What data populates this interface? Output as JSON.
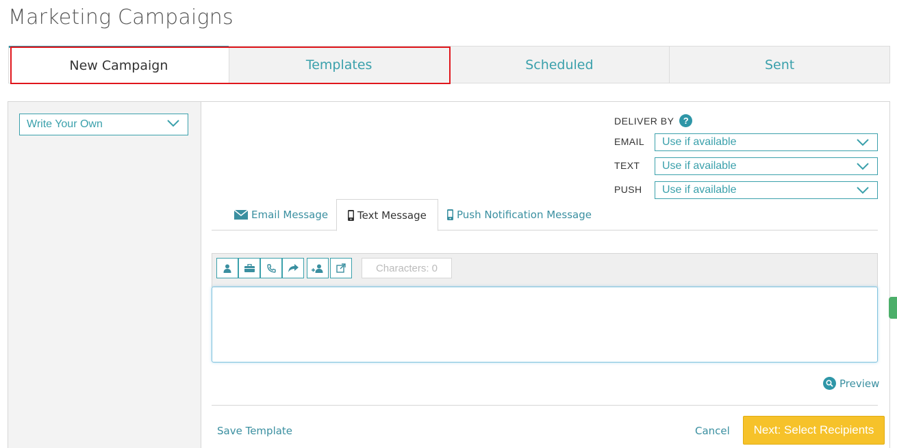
{
  "page": {
    "title": "Marketing Campaigns"
  },
  "top_tabs": [
    {
      "label": "New Campaign",
      "active": true
    },
    {
      "label": "Templates",
      "active": false
    },
    {
      "label": "Scheduled",
      "active": false
    },
    {
      "label": "Sent",
      "active": false
    }
  ],
  "sidebar": {
    "template_select": "Write Your Own"
  },
  "deliver_by": {
    "title": "DELIVER BY",
    "help_icon": "question-circle-icon",
    "rows": [
      {
        "label": "EMAIL",
        "value": "Use if available"
      },
      {
        "label": "TEXT",
        "value": "Use if available"
      },
      {
        "label": "PUSH",
        "value": "Use if available"
      }
    ]
  },
  "message_tabs": [
    {
      "label": "Email Message",
      "icon": "envelope-icon",
      "active": false
    },
    {
      "label": "Text Message",
      "icon": "mobile-phone-icon",
      "active": true
    },
    {
      "label": "Push Notification Message",
      "icon": "mobile-phone-icon",
      "active": false
    }
  ],
  "toolbar": {
    "buttons": [
      "user-icon",
      "briefcase-icon",
      "phone-icon",
      "share-icon",
      "add-user-icon",
      "external-link-icon"
    ],
    "characters": "Characters: 0"
  },
  "editor": {
    "value": ""
  },
  "preview": {
    "label": "Preview",
    "icon": "search-icon"
  },
  "footer": {
    "save_template": "Save Template",
    "cancel": "Cancel",
    "next": "Next: Select Recipients"
  },
  "colors": {
    "accent": "#3aa0ab",
    "highlight": "#e0161c",
    "next_button": "#f6c22a"
  }
}
